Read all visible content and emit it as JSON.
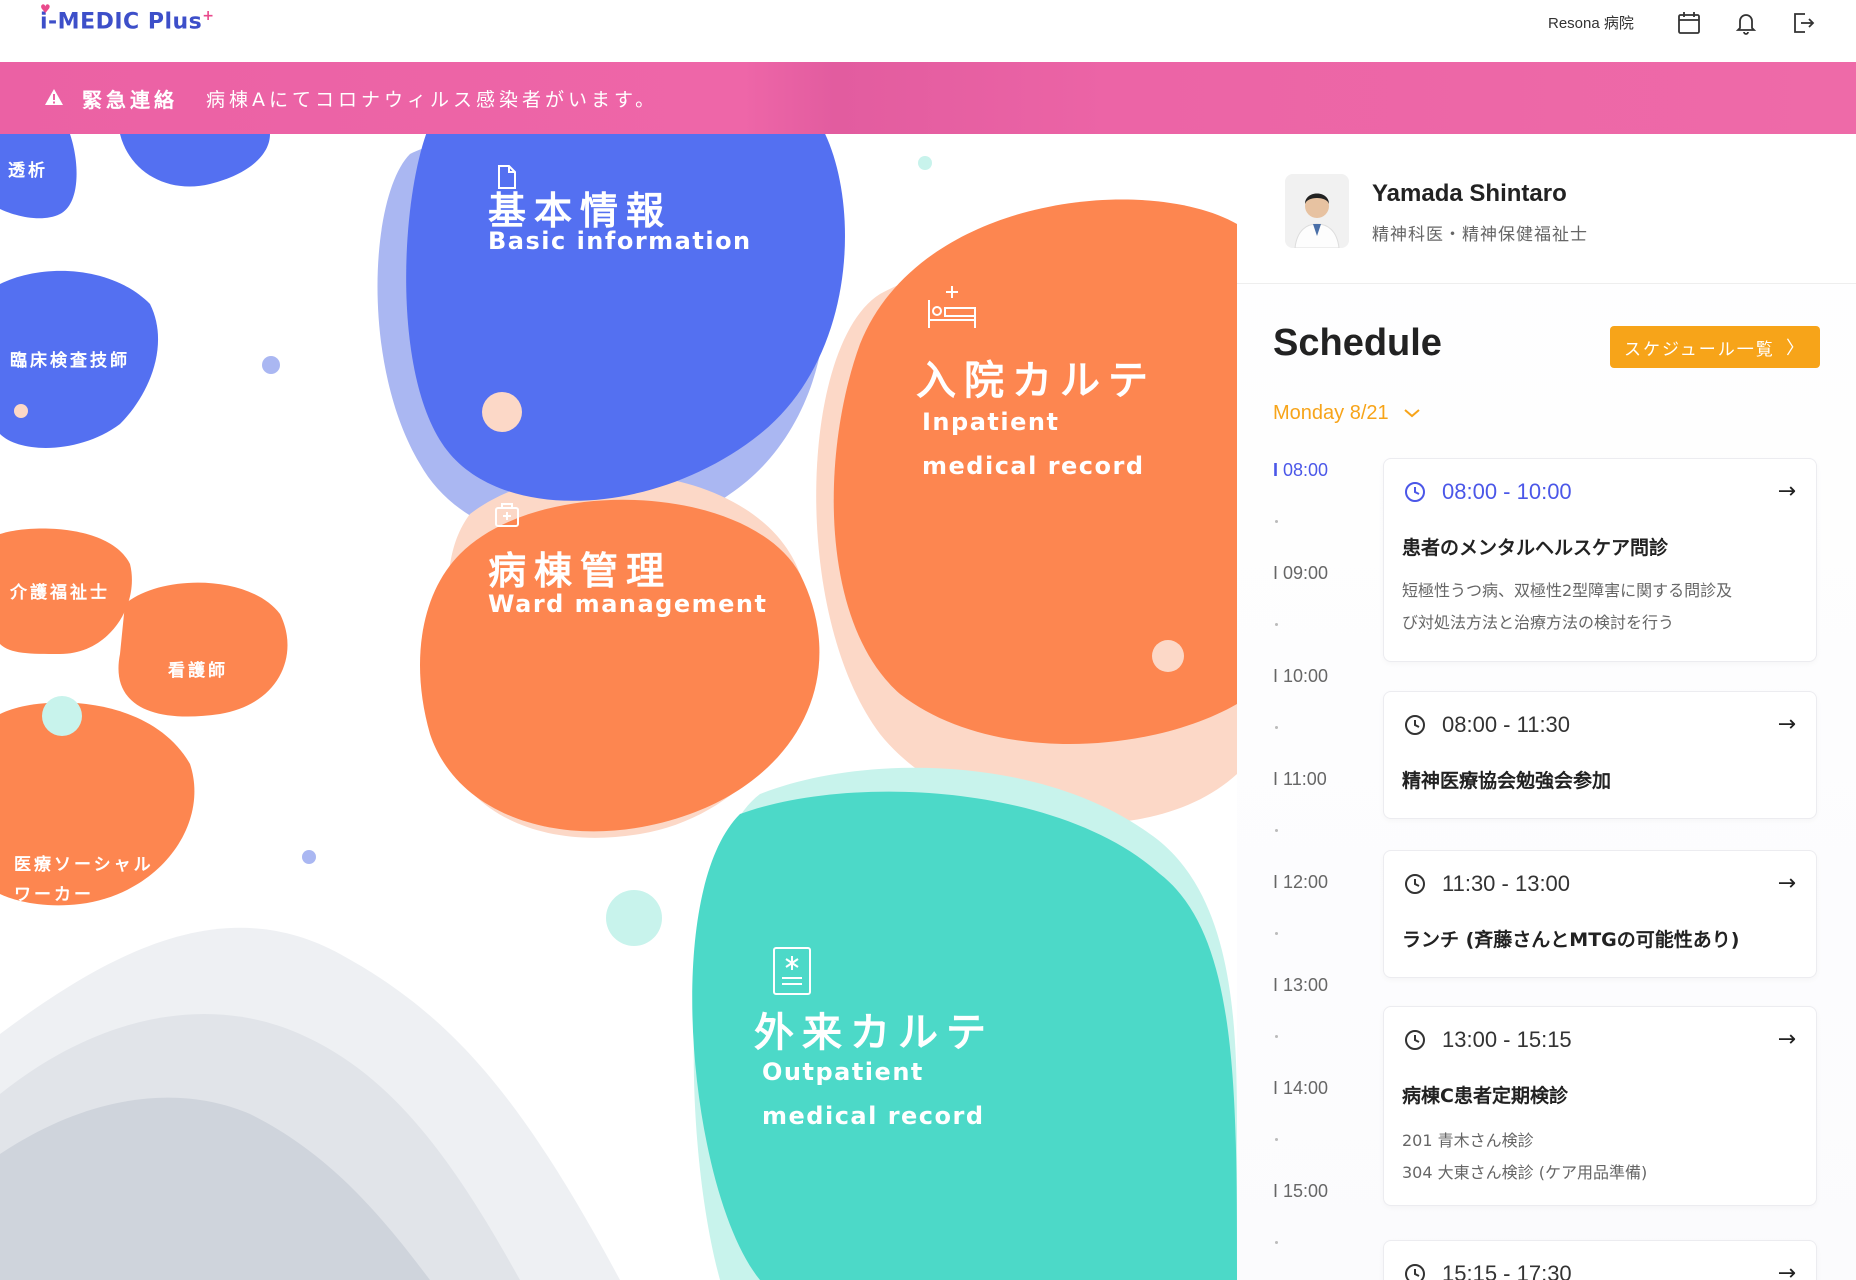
{
  "header": {
    "logo_text": "i-MEDIC Plus",
    "hospital": "Resona 病院",
    "icons": [
      "calendar-icon",
      "bell-icon",
      "logout-icon"
    ]
  },
  "alert": {
    "label": "緊急連絡",
    "message": "病棟Aにてコロナウィルス感染者がいます。"
  },
  "menu": {
    "basic": {
      "title": "基本情報",
      "subtitle": "Basic information"
    },
    "inpatient": {
      "title": "入院カルテ",
      "subtitle1": "Inpatient",
      "subtitle2": "medical record"
    },
    "ward": {
      "title": "病棟管理",
      "subtitle": "Ward management"
    },
    "outpatient": {
      "title": "外来カルテ",
      "subtitle1": "Outpatient",
      "subtitle2": "medical record"
    },
    "small": {
      "dialysis": "透析",
      "lab": "臨床検査技師",
      "care": "介護福祉士",
      "nurse": "看護師",
      "social1": "医療ソーシャル",
      "social2": "ワーカー"
    }
  },
  "colors": {
    "blue": "#5470f1",
    "orange": "#fd8650",
    "teal": "#4cd9c8",
    "pink": "#ec64a6",
    "accent": "#f7a419"
  },
  "profile": {
    "name": "Yamada Shintaro",
    "role": "精神科医・精神保健福祉士"
  },
  "schedule": {
    "title": "Schedule",
    "list_button": "スケジュール一覧",
    "date": "Monday 8/21",
    "times": [
      "08:00",
      "09:00",
      "10:00",
      "11:00",
      "12:00",
      "13:00",
      "14:00",
      "15:00"
    ],
    "events": [
      {
        "time": "08:00 - 10:00",
        "title": "患者のメンタルヘルスケア問診",
        "desc1": "短極性うつ病、双極性2型障害に関する問診及",
        "desc2": "び対処法方法と治療方法の検討を行う"
      },
      {
        "time": "08:00 - 11:30",
        "title": "精神医療協会勉強会参加"
      },
      {
        "time": "11:30 - 13:00",
        "title": "ランチ (斉藤さんとMTGの可能性あり)"
      },
      {
        "time": "13:00 - 15:15",
        "title": "病棟C患者定期検診",
        "desc1": "201  青木さん検診",
        "desc2": "304  大東さん検診 (ケア用品準備)"
      },
      {
        "time": "15:15 - 17:30"
      }
    ]
  }
}
